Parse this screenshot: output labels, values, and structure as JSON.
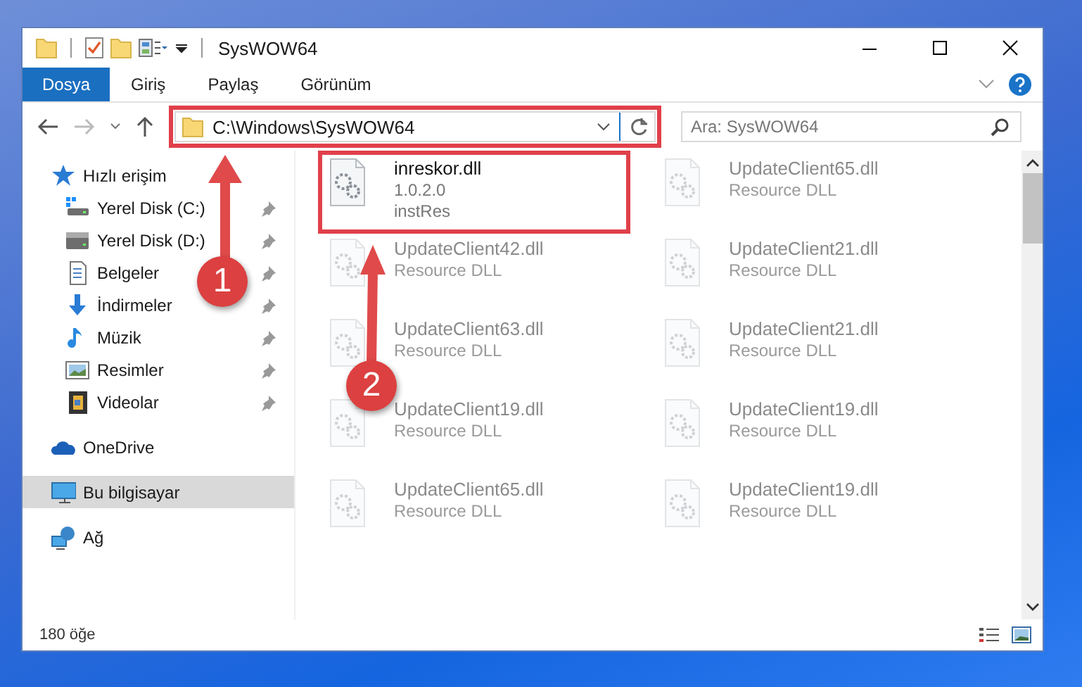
{
  "window": {
    "title": "SysWOW64"
  },
  "ribbon_tabs": [
    {
      "label": "Dosya",
      "selected": true
    },
    {
      "label": "Giriş",
      "selected": false
    },
    {
      "label": "Paylaş",
      "selected": false
    },
    {
      "label": "Görünüm",
      "selected": false
    }
  ],
  "address": {
    "path": "C:\\Windows\\SysWOW64",
    "highlighted": true
  },
  "search": {
    "placeholder": "Ara: SysWOW64"
  },
  "sidebar": {
    "items": [
      {
        "label": "Hızlı erişim",
        "kind": "star",
        "selected": false,
        "children": [
          {
            "label": "Yerel Disk (C:)",
            "kind": "drive-c",
            "pinned": true,
            "selected": false
          },
          {
            "label": "Yerel Disk (D:)",
            "kind": "drive",
            "pinned": true,
            "selected": false
          },
          {
            "label": "Belgeler",
            "kind": "document",
            "pinned": true,
            "selected": false
          },
          {
            "label": "İndirmeler",
            "kind": "download",
            "pinned": true,
            "selected": false
          },
          {
            "label": "Müzik",
            "kind": "music",
            "pinned": true,
            "selected": false
          },
          {
            "label": "Resimler",
            "kind": "pictures",
            "pinned": true,
            "selected": false
          },
          {
            "label": "Videolar",
            "kind": "video",
            "pinned": true,
            "selected": false
          }
        ]
      },
      {
        "label": "OneDrive",
        "kind": "cloud",
        "selected": false
      },
      {
        "label": "Bu bilgisayar",
        "kind": "computer",
        "selected": true
      },
      {
        "label": "Ağ",
        "kind": "network",
        "selected": false
      }
    ]
  },
  "files": [
    {
      "name": "inreskor.dll",
      "lines": [
        "1.0.2.0",
        "instRes"
      ],
      "faded": false,
      "highlighted": true
    },
    {
      "name": "UpdateClient65.dll",
      "lines": [
        "Resource DLL"
      ],
      "faded": true
    },
    {
      "name": "UpdateClient42.dll",
      "lines": [
        "Resource DLL"
      ],
      "faded": true
    },
    {
      "name": "UpdateClient21.dll",
      "lines": [
        "Resource DLL"
      ],
      "faded": true
    },
    {
      "name": "UpdateClient63.dll",
      "lines": [
        "Resource DLL"
      ],
      "faded": true
    },
    {
      "name": "UpdateClient21.dll",
      "lines": [
        "Resource DLL"
      ],
      "faded": true
    },
    {
      "name": "UpdateClient19.dll",
      "lines": [
        "Resource DLL"
      ],
      "faded": true
    },
    {
      "name": "UpdateClient19.dll",
      "lines": [
        "Resource DLL"
      ],
      "faded": true
    },
    {
      "name": "UpdateClient65.dll",
      "lines": [
        "Resource DLL"
      ],
      "faded": true
    },
    {
      "name": "UpdateClient19.dll",
      "lines": [
        "Resource DLL"
      ],
      "faded": true
    }
  ],
  "status_bar": {
    "count": "180 öğe"
  },
  "annotations": [
    {
      "label": "1"
    },
    {
      "label": "2"
    }
  ]
}
